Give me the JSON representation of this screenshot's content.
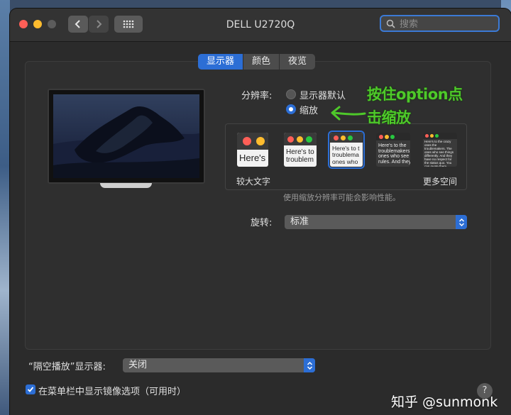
{
  "window": {
    "title": "DELL U2720Q",
    "search_placeholder": "搜索"
  },
  "tabs": [
    {
      "label": "显示器",
      "active": true
    },
    {
      "label": "颜色",
      "active": false
    },
    {
      "label": "夜览",
      "active": false
    }
  ],
  "resolution": {
    "label": "分辨率:",
    "options": [
      {
        "label": "显示器默认",
        "selected": false
      },
      {
        "label": "缩放",
        "selected": true
      }
    ]
  },
  "scaling": {
    "thumbnails": [
      {
        "text": "Here's",
        "selected": false
      },
      {
        "text": "Here's to troublem",
        "selected": false
      },
      {
        "text": "Here's to t troublema ones who",
        "selected": true
      },
      {
        "text": "Here's to the troublemakers. ones who see t rules. And they",
        "selected": false
      },
      {
        "text": "Here's to the crazy ones the troublemakers. The ones who see things differently. And they have no respect for the status quo. You can quote them, disagree with them, glorify or vilify them. About the only thing you can't do is ignore them.",
        "selected": false
      }
    ],
    "left_caption": "较大文字",
    "right_caption": "更多空间",
    "hint": "使用缩放分辨率可能会影响性能。"
  },
  "rotation": {
    "label": "旋转:",
    "value": "标准"
  },
  "airplay": {
    "label": "“隔空播放”显示器:",
    "value": "关闭"
  },
  "menubar_option": {
    "label": "在菜单栏中显示镜像选项（可用时）",
    "checked": true
  },
  "annotation": {
    "line1": "按住option点",
    "line2": "击缩放",
    "color": "#4ec92a"
  },
  "watermark": "知乎 @sunmonk",
  "colors": {
    "accent": "#2c6ed5",
    "window_bg": "#2b2b2b"
  }
}
